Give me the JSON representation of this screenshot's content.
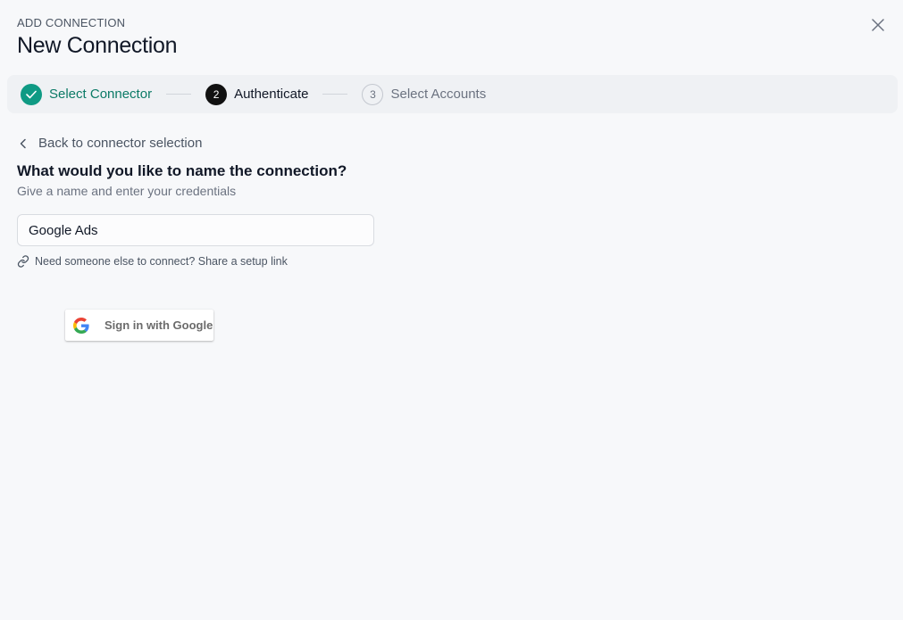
{
  "header": {
    "eyebrow": "ADD CONNECTION",
    "title": "New Connection",
    "close_icon": "close-icon"
  },
  "stepper": {
    "steps": [
      {
        "label": "Select Connector",
        "status": "completed",
        "marker": "✓"
      },
      {
        "label": "Authenticate",
        "status": "active",
        "marker": "2"
      },
      {
        "label": "Select Accounts",
        "status": "pending",
        "marker": "3"
      }
    ]
  },
  "form": {
    "back_label": "Back to connector selection",
    "question": "What would you like to name the connection?",
    "subtitle": "Give a name and enter your credentials",
    "name_value": "Google Ads",
    "share_link_label": "Need someone else to connect? Share a setup link",
    "google_button_label": "Sign in with Google"
  },
  "colors": {
    "background": "#f7f8fa",
    "stepper_bg": "#eff1f4",
    "done": "#0f9a84",
    "done_text": "#0b7a66",
    "active": "#111111"
  }
}
